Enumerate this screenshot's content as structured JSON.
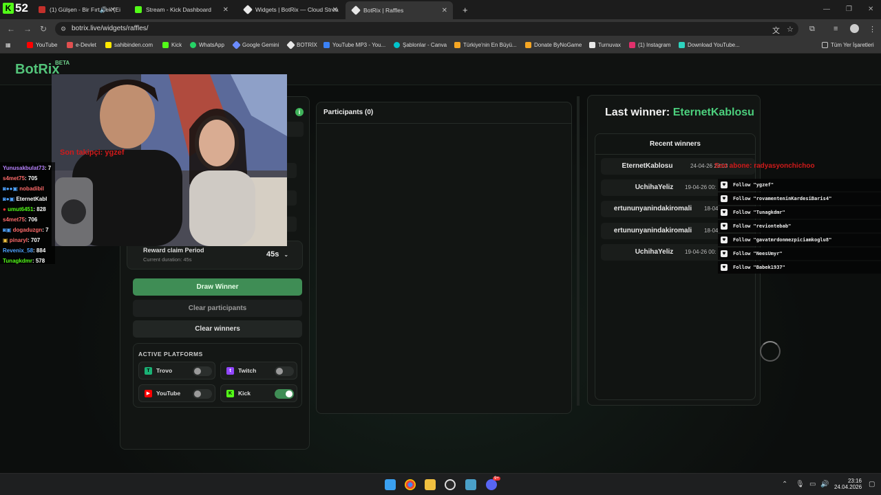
{
  "browser": {
    "kick_count": "52",
    "tabs": [
      {
        "title": "(1) Gülşen - Bir Fırt Çek (Ei",
        "close": "✕",
        "color": "#c4302b"
      },
      {
        "title": "Stream - Kick Dashboard",
        "close": "✕",
        "color": "#53fc18"
      },
      {
        "title": "Widgets | BotRix — Cloud Strea",
        "close": "✕",
        "color": "#e8e8e8"
      },
      {
        "title": "BotRix | Raffles",
        "close": "✕",
        "color": "#e8e8e8"
      }
    ],
    "new_tab": "+",
    "url": "botrix.live/widgets/raffles/",
    "bookmarks": [
      {
        "label": "YouTube",
        "color": "#ff0000"
      },
      {
        "label": "e-Devlet",
        "color": "#e05050"
      },
      {
        "label": "sahibinden.com",
        "color": "#ffe800"
      },
      {
        "label": "Kick",
        "color": "#53fc18"
      },
      {
        "label": "WhatsApp",
        "color": "#25d366"
      },
      {
        "label": "Google Gemini",
        "color": "#6b8cff"
      },
      {
        "label": "BOTRİX",
        "color": "#e8e8e8"
      },
      {
        "label": "YouTube MP3 - You...",
        "color": "#3b82f6"
      },
      {
        "label": "Şablonlar - Canva",
        "color": "#00c4cc"
      },
      {
        "label": "Türkiye'nin En Büyü...",
        "color": "#f5a623"
      },
      {
        "label": "Donate ByNoGame",
        "color": "#f5a623"
      },
      {
        "label": "Turnuvax",
        "color": "#e8e8e8"
      },
      {
        "label": "(1) Instagram",
        "color": "#e1306c"
      },
      {
        "label": "Download YouTube...",
        "color": "#2dd4bf"
      }
    ],
    "all_bookmarks": "Tüm Yer İşaretleri"
  },
  "site": {
    "logo": "BotRix",
    "beta": "BETA"
  },
  "settings": {
    "reward_title": "Reward claim Period",
    "reward_sub": "Current duration: 45s",
    "reward_value": "45s",
    "draw_winner": "Draw Winner",
    "clear_participants": "Clear participants",
    "clear_winners": "Clear winners",
    "platforms_title": "ACTIVE PLATFORMS",
    "platforms": [
      {
        "name": "Trovo",
        "enabled": false,
        "color": "#1ab275"
      },
      {
        "name": "Twitch",
        "enabled": false,
        "color": "#9146ff"
      },
      {
        "name": "YouTube",
        "enabled": false,
        "color": "#ff0000"
      },
      {
        "name": "Kick",
        "enabled": true,
        "color": "#53fc18"
      }
    ]
  },
  "participants": {
    "title": "Participants (0)"
  },
  "winners": {
    "last_winner_label": "Last winner:",
    "last_winner_name": "EternetKablosu",
    "recent_title": "Recent winners",
    "rows": [
      {
        "name": "EternetKablosu",
        "date": "24-04-26 23:03"
      },
      {
        "name": "UchihaYeliz",
        "date": "19-04-26 00:"
      },
      {
        "name": "ertununyanindakiromali",
        "date": "18-04"
      },
      {
        "name": "ertununyanindakiromali",
        "date": "18-04"
      },
      {
        "name": "UchihaYeliz",
        "date": "19-04-26 00:"
      }
    ]
  },
  "overlay": {
    "cam_text": "Son takipçi: ygzef",
    "sub_text": "Son abone: radyasyonchichoo",
    "chat": [
      {
        "user": "Yunusakbulat73",
        "value": ": 7",
        "color": "#b983ff"
      },
      {
        "user": "s4met75",
        "value": ": 705",
        "color": "#ff6b6b"
      },
      {
        "user": "nobadibil",
        "value": "",
        "color": "#ff6b6b"
      },
      {
        "user": "EternetKabl",
        "value": "",
        "color": "#ffffff"
      },
      {
        "user": "umut6451",
        "value": ": 828",
        "color": "#53fc18"
      },
      {
        "user": "s4met75",
        "value": ": 706",
        "color": "#ff6b6b"
      },
      {
        "user": "dogaduzgn",
        "value": ": 7",
        "color": "#ff6b6b"
      },
      {
        "user": "pinaryl",
        "value": ": 707",
        "color": "#ff6b6b"
      },
      {
        "user": "Revenix_58",
        "value": ": 884",
        "color": "#4fa3ff"
      },
      {
        "user": "Tunagkdmr",
        "value": ": 578",
        "color": "#53fc18"
      }
    ],
    "follows": [
      "Follow \"ygzef\"",
      "Follow \"rovamenteninKardesiBaris4\"",
      "Follow \"Tunagkdmr\"",
      "Follow \"reviontebab\"",
      "Follow \"gavatmrdonmezpiciamkoglu8\"",
      "Follow \"NeesUmyr\"",
      "Follow \"Babek1937\""
    ]
  },
  "taskbar": {
    "time": "23:16",
    "date": "24.04.2026",
    "discord_badge": "9+"
  }
}
